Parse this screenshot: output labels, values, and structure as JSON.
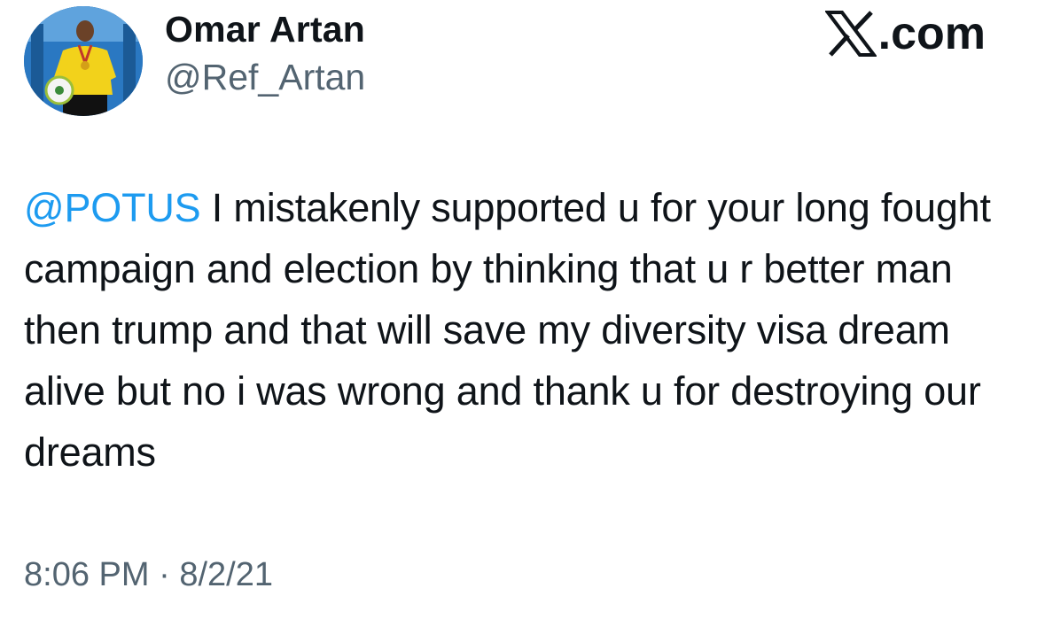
{
  "author": {
    "display_name": "Omar Artan",
    "handle": "@Ref_Artan",
    "avatar_icon": "profile-photo-referee-with-ball"
  },
  "brand": {
    "label": ".com",
    "icon": "x-logo-icon"
  },
  "tweet": {
    "mention": "@POTUS",
    "text": " I mistakenly supported u for your long fought campaign and election by thinking that u r better man then trump and that will save my diversity visa dream alive but no i was wrong and thank u for destroying our dreams"
  },
  "meta": {
    "time": "8:06 PM",
    "separator": " · ",
    "date": "8/2/21"
  },
  "colors": {
    "mention": "#1d9bf0",
    "secondary_text": "#536471",
    "primary_text": "#0f1419"
  }
}
